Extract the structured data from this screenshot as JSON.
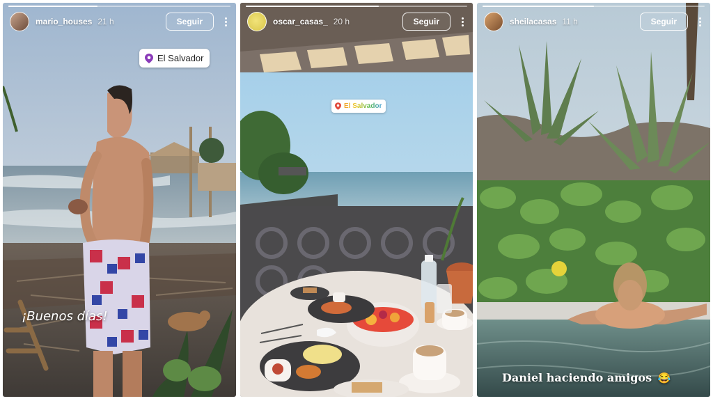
{
  "stories": [
    {
      "username": "mario_houses",
      "time": "21 h",
      "follow_label": "Seguir",
      "location": "El Salvador",
      "caption": "¡Buenos días!",
      "progress": 0.4
    },
    {
      "username": "oscar_casas_",
      "time": "20 h",
      "follow_label": "Seguir",
      "location": "El Salvador",
      "progress": 0.6
    },
    {
      "username": "sheilacasas",
      "time": "11 h",
      "follow_label": "Seguir",
      "caption": "Daniel haciendo amigos",
      "caption_emoji": "😂",
      "progress": 0.5
    }
  ],
  "colors": {
    "location_pin": "#8a3ab9",
    "follow_border": "#ffffff"
  }
}
